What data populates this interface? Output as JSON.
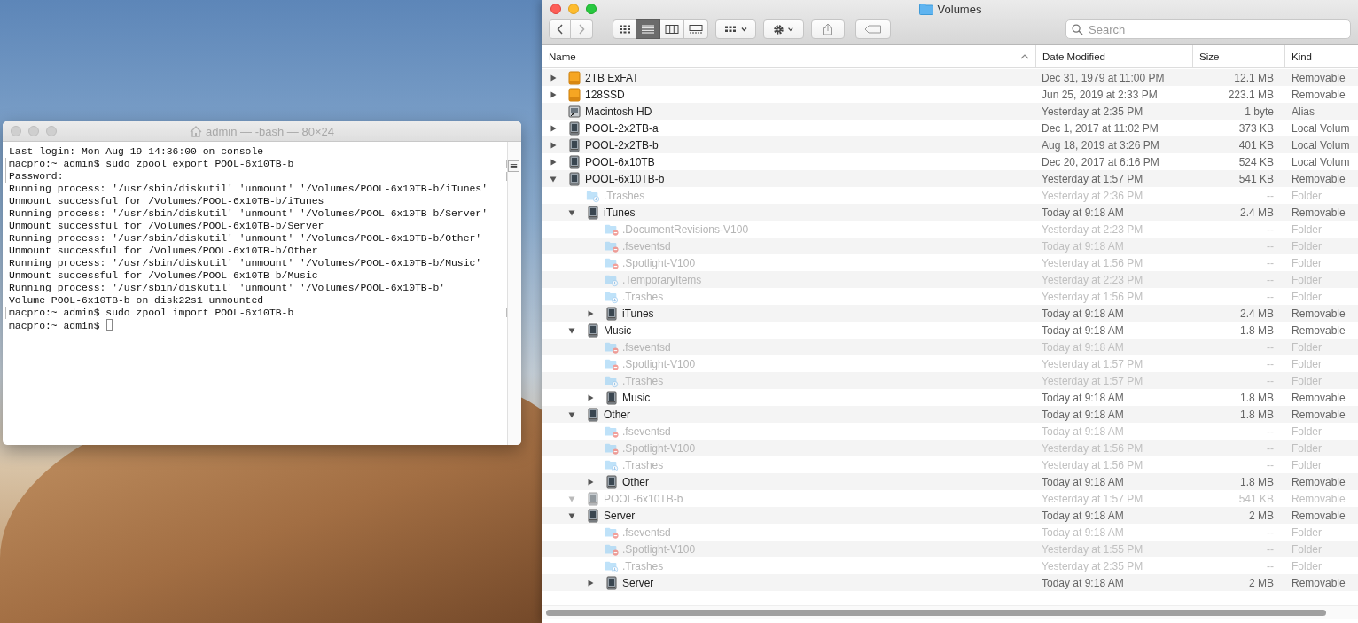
{
  "terminal": {
    "title": "admin — -bash — 80×24",
    "lines": [
      {
        "text": "Last login: Mon Aug 19 14:36:00 on console",
        "marked": false
      },
      {
        "text": "macpro:~ admin$ sudo zpool export POOL-6x10TB-b",
        "marked": true
      },
      {
        "text": "Password:",
        "marked": true
      },
      {
        "text": "Running process: '/usr/sbin/diskutil' 'unmount' '/Volumes/POOL-6x10TB-b/iTunes'",
        "marked": false
      },
      {
        "text": "Unmount successful for /Volumes/POOL-6x10TB-b/iTunes",
        "marked": false
      },
      {
        "text": "Running process: '/usr/sbin/diskutil' 'unmount' '/Volumes/POOL-6x10TB-b/Server'",
        "marked": false
      },
      {
        "text": "Unmount successful for /Volumes/POOL-6x10TB-b/Server",
        "marked": false
      },
      {
        "text": "Running process: '/usr/sbin/diskutil' 'unmount' '/Volumes/POOL-6x10TB-b/Other'",
        "marked": false
      },
      {
        "text": "Unmount successful for /Volumes/POOL-6x10TB-b/Other",
        "marked": false
      },
      {
        "text": "Running process: '/usr/sbin/diskutil' 'unmount' '/Volumes/POOL-6x10TB-b/Music'",
        "marked": false
      },
      {
        "text": "Unmount successful for /Volumes/POOL-6x10TB-b/Music",
        "marked": false
      },
      {
        "text": "Running process: '/usr/sbin/diskutil' 'unmount' '/Volumes/POOL-6x10TB-b'",
        "marked": false
      },
      {
        "text": "Volume POOL-6x10TB-b on disk22s1 unmounted",
        "marked": false
      },
      {
        "text": "macpro:~ admin$ sudo zpool import POOL-6x10TB-b",
        "marked": true
      },
      {
        "text": "macpro:~ admin$",
        "marked": false
      }
    ]
  },
  "finder": {
    "title": "Volumes",
    "view_modes": [
      {
        "kind": "icons",
        "selected": false
      },
      {
        "kind": "list",
        "selected": true
      },
      {
        "kind": "columns",
        "selected": false
      },
      {
        "kind": "gallery",
        "selected": false
      }
    ],
    "search": {
      "placeholder": "Search"
    },
    "columns": [
      "Name",
      "Date Modified",
      "Size",
      "Kind"
    ],
    "rows": [
      {
        "kind": "external-drive",
        "name": "2TB ExFAT",
        "date_modified": "Dec 31, 1979 at 11:00 PM",
        "size": "12.1 MB",
        "kind_text": "Removable",
        "dimmed": false,
        "expanded": false
      },
      {
        "kind": "external-drive",
        "name": "128SSD",
        "date_modified": "Jun 25, 2019 at 2:33 PM",
        "size": "223.1 MB",
        "kind_text": "Removable",
        "dimmed": false,
        "expanded": false
      },
      {
        "kind": "alias-drive",
        "name": "Macintosh HD",
        "date_modified": "Yesterday at 2:35 PM",
        "size": "1 byte",
        "kind_text": "Alias",
        "dimmed": false
      },
      {
        "kind": "drive",
        "name": "POOL-2x2TB-a",
        "date_modified": "Dec 1, 2017 at 11:02 PM",
        "size": "373 KB",
        "kind_text": "Local Volum",
        "dimmed": false,
        "expanded": false
      },
      {
        "kind": "drive",
        "name": "POOL-2x2TB-b",
        "date_modified": "Aug 18, 2019 at 3:26 PM",
        "size": "401 KB",
        "kind_text": "Local Volum",
        "dimmed": false,
        "expanded": false
      },
      {
        "kind": "drive",
        "name": "POOL-6x10TB",
        "date_modified": "Dec 20, 2017 at 6:16 PM",
        "size": "524 KB",
        "kind_text": "Local Volum",
        "dimmed": false,
        "expanded": false
      },
      {
        "kind": "drive",
        "name": "POOL-6x10TB-b",
        "date_modified": "Yesterday at 1:57 PM",
        "size": "541 KB",
        "kind_text": "Removable",
        "dimmed": false,
        "expanded": true,
        "children": [
          {
            "kind": "folder-download",
            "name": ".Trashes",
            "date_modified": "Yesterday at 2:36 PM",
            "size": "--",
            "kind_text": "Folder",
            "dimmed": true
          },
          {
            "kind": "drive",
            "name": "iTunes",
            "date_modified": "Today at 9:18 AM",
            "size": "2.4 MB",
            "kind_text": "Removable",
            "dimmed": false,
            "expanded": true,
            "children": [
              {
                "kind": "folder-restricted",
                "name": ".DocumentRevisions-V100",
                "date_modified": "Yesterday at 2:23 PM",
                "size": "--",
                "kind_text": "Folder",
                "dimmed": true
              },
              {
                "kind": "folder-restricted",
                "name": ".fseventsd",
                "date_modified": "Today at 9:18 AM",
                "size": "--",
                "kind_text": "Folder",
                "dimmed": true
              },
              {
                "kind": "folder-restricted",
                "name": ".Spotlight-V100",
                "date_modified": "Yesterday at 1:56 PM",
                "size": "--",
                "kind_text": "Folder",
                "dimmed": true
              },
              {
                "kind": "folder-download",
                "name": ".TemporaryItems",
                "date_modified": "Yesterday at 2:23 PM",
                "size": "--",
                "kind_text": "Folder",
                "dimmed": true
              },
              {
                "kind": "folder-download",
                "name": ".Trashes",
                "date_modified": "Yesterday at 1:56 PM",
                "size": "--",
                "kind_text": "Folder",
                "dimmed": true
              },
              {
                "kind": "drive",
                "name": "iTunes",
                "date_modified": "Today at 9:18 AM",
                "size": "2.4 MB",
                "kind_text": "Removable",
                "dimmed": false,
                "expanded": false
              }
            ]
          },
          {
            "kind": "drive",
            "name": "Music",
            "date_modified": "Today at 9:18 AM",
            "size": "1.8 MB",
            "kind_text": "Removable",
            "dimmed": false,
            "expanded": true,
            "children": [
              {
                "kind": "folder-restricted",
                "name": ".fseventsd",
                "date_modified": "Today at 9:18 AM",
                "size": "--",
                "kind_text": "Folder",
                "dimmed": true
              },
              {
                "kind": "folder-restricted",
                "name": ".Spotlight-V100",
                "date_modified": "Yesterday at 1:57 PM",
                "size": "--",
                "kind_text": "Folder",
                "dimmed": true
              },
              {
                "kind": "folder-download",
                "name": ".Trashes",
                "date_modified": "Yesterday at 1:57 PM",
                "size": "--",
                "kind_text": "Folder",
                "dimmed": true
              },
              {
                "kind": "drive",
                "name": "Music",
                "date_modified": "Today at 9:18 AM",
                "size": "1.8 MB",
                "kind_text": "Removable",
                "dimmed": false,
                "expanded": false
              }
            ]
          },
          {
            "kind": "drive",
            "name": "Other",
            "date_modified": "Today at 9:18 AM",
            "size": "1.8 MB",
            "kind_text": "Removable",
            "dimmed": false,
            "expanded": true,
            "children": [
              {
                "kind": "folder-restricted",
                "name": ".fseventsd",
                "date_modified": "Today at 9:18 AM",
                "size": "--",
                "kind_text": "Folder",
                "dimmed": true
              },
              {
                "kind": "folder-restricted",
                "name": ".Spotlight-V100",
                "date_modified": "Yesterday at 1:56 PM",
                "size": "--",
                "kind_text": "Folder",
                "dimmed": true
              },
              {
                "kind": "folder-download",
                "name": ".Trashes",
                "date_modified": "Yesterday at 1:56 PM",
                "size": "--",
                "kind_text": "Folder",
                "dimmed": true
              },
              {
                "kind": "drive",
                "name": "Other",
                "date_modified": "Today at 9:18 AM",
                "size": "1.8 MB",
                "kind_text": "Removable",
                "dimmed": false,
                "expanded": false
              }
            ]
          },
          {
            "kind": "drive",
            "name": "POOL-6x10TB-b",
            "date_modified": "Yesterday at 1:57 PM",
            "size": "541 KB",
            "kind_text": "Removable",
            "dimmed": true,
            "expanded": true
          },
          {
            "kind": "drive",
            "name": "Server",
            "date_modified": "Today at 9:18 AM",
            "size": "2 MB",
            "kind_text": "Removable",
            "dimmed": false,
            "expanded": true,
            "children": [
              {
                "kind": "folder-restricted",
                "name": ".fseventsd",
                "date_modified": "Today at 9:18 AM",
                "size": "--",
                "kind_text": "Folder",
                "dimmed": true
              },
              {
                "kind": "folder-restricted",
                "name": ".Spotlight-V100",
                "date_modified": "Yesterday at 1:55 PM",
                "size": "--",
                "kind_text": "Folder",
                "dimmed": true
              },
              {
                "kind": "folder-download",
                "name": ".Trashes",
                "date_modified": "Yesterday at 2:35 PM",
                "size": "--",
                "kind_text": "Folder",
                "dimmed": true
              },
              {
                "kind": "drive",
                "name": "Server",
                "date_modified": "Today at 9:18 AM",
                "size": "2 MB",
                "kind_text": "Removable",
                "dimmed": false,
                "expanded": false
              }
            ]
          }
        ]
      }
    ]
  }
}
